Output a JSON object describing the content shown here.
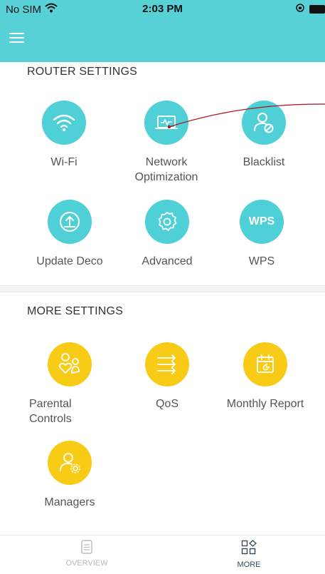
{
  "status_bar": {
    "carrier": "No SIM",
    "time": "2:03 PM"
  },
  "colors": {
    "header": "#58d1d6",
    "teal_icon": "#4fd0d6",
    "yellow_icon": "#f8cc16",
    "tab_active": "#3a4a5a",
    "tab_inactive": "#bbbbbb"
  },
  "router_settings": {
    "title": "ROUTER SETTINGS",
    "items": [
      {
        "label": "Wi-Fi",
        "icon": "wifi-icon"
      },
      {
        "label": "Network Optimization",
        "icon": "network-optimization-icon"
      },
      {
        "label": "Blacklist",
        "icon": "blacklist-icon"
      },
      {
        "label": "Update Deco",
        "icon": "update-icon"
      },
      {
        "label": "Advanced",
        "icon": "gear-icon"
      },
      {
        "label": "WPS",
        "icon": "wps-icon",
        "icon_text": "WPS"
      }
    ]
  },
  "more_settings": {
    "title": "MORE SETTINGS",
    "items": [
      {
        "label": "Parental Controls",
        "icon": "parental-controls-icon"
      },
      {
        "label": "QoS",
        "icon": "qos-icon"
      },
      {
        "label": "Monthly Report",
        "icon": "calendar-icon"
      },
      {
        "label": "Managers",
        "icon": "managers-icon"
      }
    ]
  },
  "tabs": [
    {
      "label": "OVERVIEW",
      "icon": "overview-icon",
      "active": false
    },
    {
      "label": "MORE",
      "icon": "more-icon",
      "active": true
    }
  ]
}
